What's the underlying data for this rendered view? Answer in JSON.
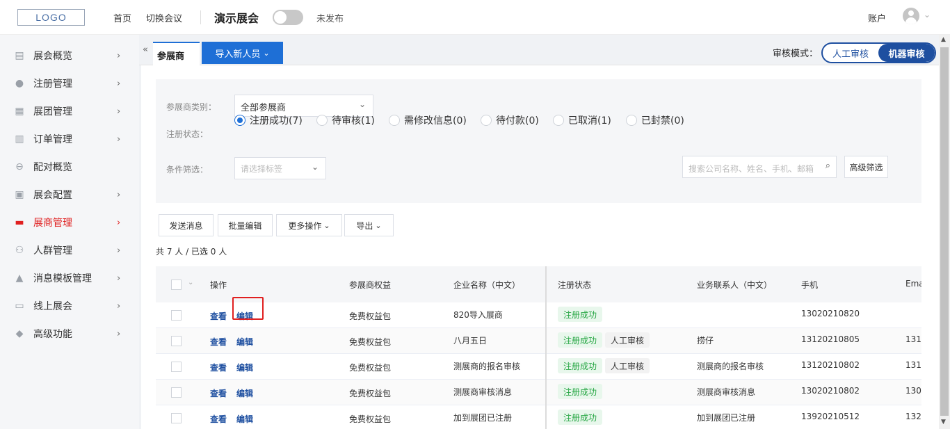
{
  "header": {
    "logo": "LOGO",
    "nav_home": "首页",
    "nav_switch": "切换会议",
    "event_title": "演示展会",
    "publish_status": "未发布",
    "account": "账户"
  },
  "sidebar": {
    "items": [
      {
        "label": "展会概览",
        "icon": "document-icon"
      },
      {
        "label": "注册管理",
        "icon": "user-settings-icon"
      },
      {
        "label": "展团管理",
        "icon": "group-icon"
      },
      {
        "label": "订单管理",
        "icon": "order-icon"
      },
      {
        "label": "配对概览",
        "icon": "pair-icon"
      },
      {
        "label": "展会配置",
        "icon": "config-icon"
      },
      {
        "label": "展商管理",
        "icon": "store-icon"
      },
      {
        "label": "人群管理",
        "icon": "people-icon"
      },
      {
        "label": "消息模板管理",
        "icon": "bell-icon"
      },
      {
        "label": "线上展会",
        "icon": "monitor-icon"
      },
      {
        "label": "高级功能",
        "icon": "tag-icon"
      }
    ],
    "active_color": "#e02020"
  },
  "tabbar": {
    "collapse": "«",
    "active_tab": "参展商",
    "import_button": "导入新人员",
    "audit_label": "审核模式：",
    "audit_manual": "人工审核",
    "audit_machine": "机器审核"
  },
  "filters": {
    "category_label": "参展商类别：",
    "category_value": "全部参展商",
    "status_label": "注册状态：",
    "status_options": [
      "注册成功(7)",
      "待审核(1)",
      "需修改信息(0)",
      "待付款(0)",
      "已取消(1)",
      "已封禁(0)"
    ],
    "condition_label": "条件筛选：",
    "condition_placeholder": "请选择标签",
    "search_placeholder": "搜索公司名称、姓名、手机、邮箱",
    "advanced_filter": "高级筛选"
  },
  "actions": {
    "send_message": "发送消息",
    "batch_edit": "批量编辑",
    "more_actions": "更多操作",
    "export": "导出",
    "count_text": "共 7 人 / 已选 0 人"
  },
  "table": {
    "headers": [
      "操作",
      "参展商权益",
      "企业名称（中文）",
      "注册状态",
      "业务联系人（中文）",
      "手机",
      "Ema"
    ],
    "view_label": "查看",
    "edit_label": "编辑",
    "rows": [
      {
        "benefit": "免费权益包",
        "company": "820导入展商",
        "status": "注册成功",
        "review": "",
        "contact": "",
        "phone": "13020210820",
        "email": ""
      },
      {
        "benefit": "免费权益包",
        "company": "八月五日",
        "status": "注册成功",
        "review": "人工审核",
        "contact": "捞仔",
        "phone": "13120210805",
        "email": "131"
      },
      {
        "benefit": "免费权益包",
        "company": "测展商的报名审核",
        "status": "注册成功",
        "review": "人工审核",
        "contact": "测展商的报名审核",
        "phone": "13120210802",
        "email": "131"
      },
      {
        "benefit": "免费权益包",
        "company": "测展商审核消息",
        "status": "注册成功",
        "review": "",
        "contact": "测展商审核消息",
        "phone": "13020210802",
        "email": "130"
      },
      {
        "benefit": "免费权益包",
        "company": "加到展团已注册",
        "status": "注册成功",
        "review": "",
        "contact": "加到展团已注册",
        "phone": "13920210512",
        "email": "132"
      }
    ]
  },
  "colors": {
    "primary": "#1e6fd6",
    "audit": "#1e4fa0",
    "success": "#28a745",
    "highlight": "#e02020"
  }
}
